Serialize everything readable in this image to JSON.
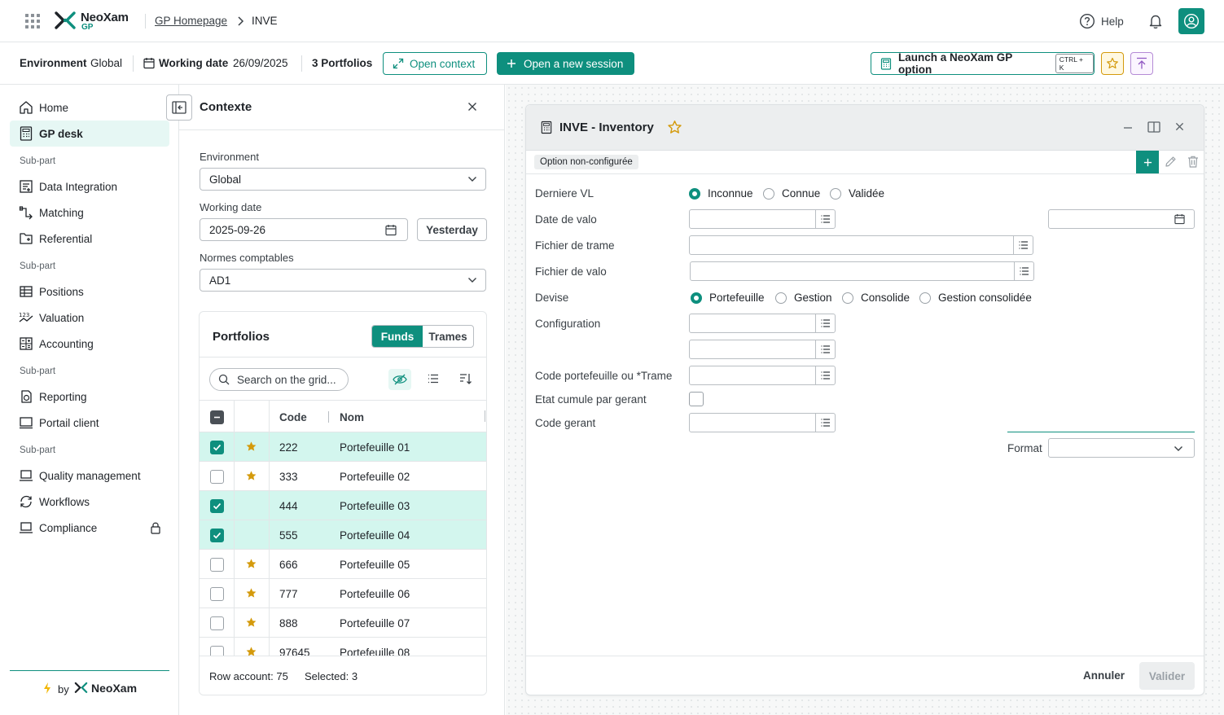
{
  "topbar": {
    "brand_name": "NeoXam",
    "brand_sub": "GP",
    "breadcrumb": [
      "GP Homepage",
      "INVE"
    ],
    "help_label": "Help"
  },
  "context_bar": {
    "env_label": "Environment",
    "env_value": "Global",
    "date_label": "Working date",
    "date_value": "26/09/2025",
    "portfolios": "3 Portfolios",
    "open_context": "Open context",
    "new_session": "Open a new session",
    "launch_option": "Launch a NeoXam GP option",
    "shortcut": "CTRL + K"
  },
  "sidebar": {
    "home": "Home",
    "gp_desk": "GP desk",
    "subpart": "Sub-part",
    "data_integration": "Data Integration",
    "matching": "Matching",
    "referential": "Referential",
    "positions": "Positions",
    "valuation": "Valuation",
    "accounting": "Accounting",
    "reporting": "Reporting",
    "portail_client": "Portail client",
    "quality": "Quality management",
    "workflows": "Workflows",
    "compliance": "Compliance",
    "footer_by": "by",
    "footer_brand": "NeoXam"
  },
  "context_panel": {
    "title": "Contexte",
    "env_label": "Environment",
    "env_value": "Global",
    "date_label": "Working date",
    "date_value": "2025-09-26",
    "yesterday": "Yesterday",
    "normes_label": "Normes comptables",
    "normes_value": "AD1",
    "portfolios_title": "Portfolios",
    "tab_funds": "Funds",
    "tab_trames": "Trames",
    "search_placeholder": "Search on the grid...",
    "col_code": "Code",
    "col_nom": "Nom",
    "rows": [
      {
        "code": "222",
        "nom": "Portefeuille 01",
        "checked": true,
        "star": true
      },
      {
        "code": "333",
        "nom": "Portefeuille 02",
        "checked": false,
        "star": true
      },
      {
        "code": "444",
        "nom": "Portefeuille 03",
        "checked": true,
        "star": false
      },
      {
        "code": "555",
        "nom": "Portefeuille 04",
        "checked": true,
        "star": false
      },
      {
        "code": "666",
        "nom": "Portefeuille 05",
        "checked": false,
        "star": true
      },
      {
        "code": "777",
        "nom": "Portefeuille 06",
        "checked": false,
        "star": true
      },
      {
        "code": "888",
        "nom": "Portefeuille 07",
        "checked": false,
        "star": true
      },
      {
        "code": "97645",
        "nom": "Portefeuille 08",
        "checked": false,
        "star": true
      }
    ],
    "row_account": "Row account: 75",
    "selected": "Selected: 3"
  },
  "inve": {
    "title": "INVE - Inventory",
    "status_tag": "Option non-configurée",
    "derniere_vl": "Derniere VL",
    "vl_options": [
      "Inconnue",
      "Connue",
      "Validée"
    ],
    "date_valo": "Date de valo",
    "fichier_trame": "Fichier de trame",
    "fichier_valo": "Fichier de valo",
    "devise": "Devise",
    "devise_options": [
      "Portefeuille",
      "Gestion",
      "Consolide",
      "Gestion consolidée"
    ],
    "configuration": "Configuration",
    "code_portefeuille": "Code portefeuille ou *Trame",
    "etat_cumule": "Etat cumule par gerant",
    "code_gerant": "Code gerant",
    "format": "Format",
    "annuler": "Annuler",
    "valider": "Valider"
  },
  "colors": {
    "accent": "#0e8f7e",
    "selected_row": "#d3f6ee",
    "star": "#d49a0c"
  }
}
